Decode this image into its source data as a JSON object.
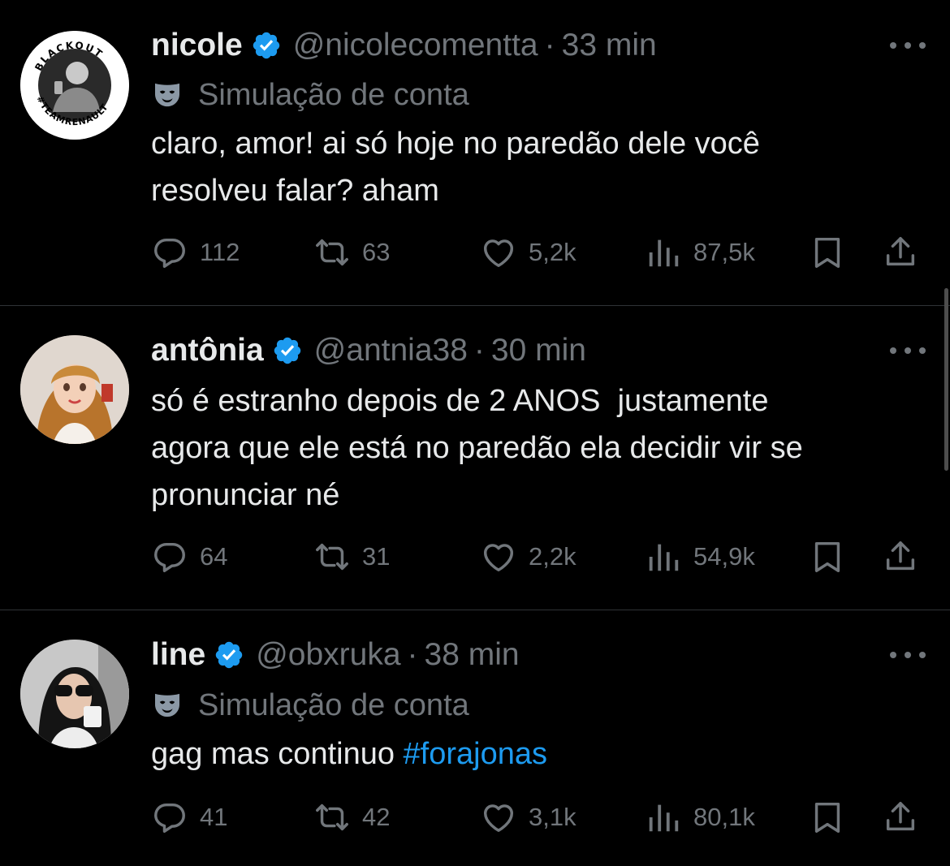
{
  "colors": {
    "background": "#000000",
    "text": "#e7e9ea",
    "muted": "#71767b",
    "accent": "#1d9bf0",
    "divider": "#2f3336"
  },
  "tweets": [
    {
      "name": "nicole",
      "handle": "@nicolecomentta",
      "separator": "·",
      "time": "33 min",
      "verified_icon": "verified-badge-icon",
      "avatar_text_top": "BLACKOUT",
      "avatar_text_bottom": "#TEAMRENAULT",
      "simulation_label": "Simulação de conta",
      "text": "claro, amor! ai só hoje no paredão dele você\nresolveu falar? aham",
      "replies": "112",
      "retweets": "63",
      "likes": "5,2k",
      "views": "87,5k"
    },
    {
      "name": "antônia",
      "handle": "@antnia38",
      "separator": "·",
      "time": "30 min",
      "verified_icon": "verified-badge-icon",
      "text": "só é estranho depois de 2 ANOS  justamente\nagora que ele está no paredão ela decidir vir se\npronunciar né",
      "replies": "64",
      "retweets": "31",
      "likes": "2,2k",
      "views": "54,9k"
    },
    {
      "name": "line",
      "handle": "@obxruka",
      "separator": "·",
      "time": "38 min",
      "verified_icon": "verified-badge-icon",
      "simulation_label": "Simulação de conta",
      "text_plain": "gag mas continuo ",
      "hashtag": "#forajonas",
      "replies": "41",
      "retweets": "42",
      "likes": "3,1k",
      "views": "80,1k"
    }
  ]
}
